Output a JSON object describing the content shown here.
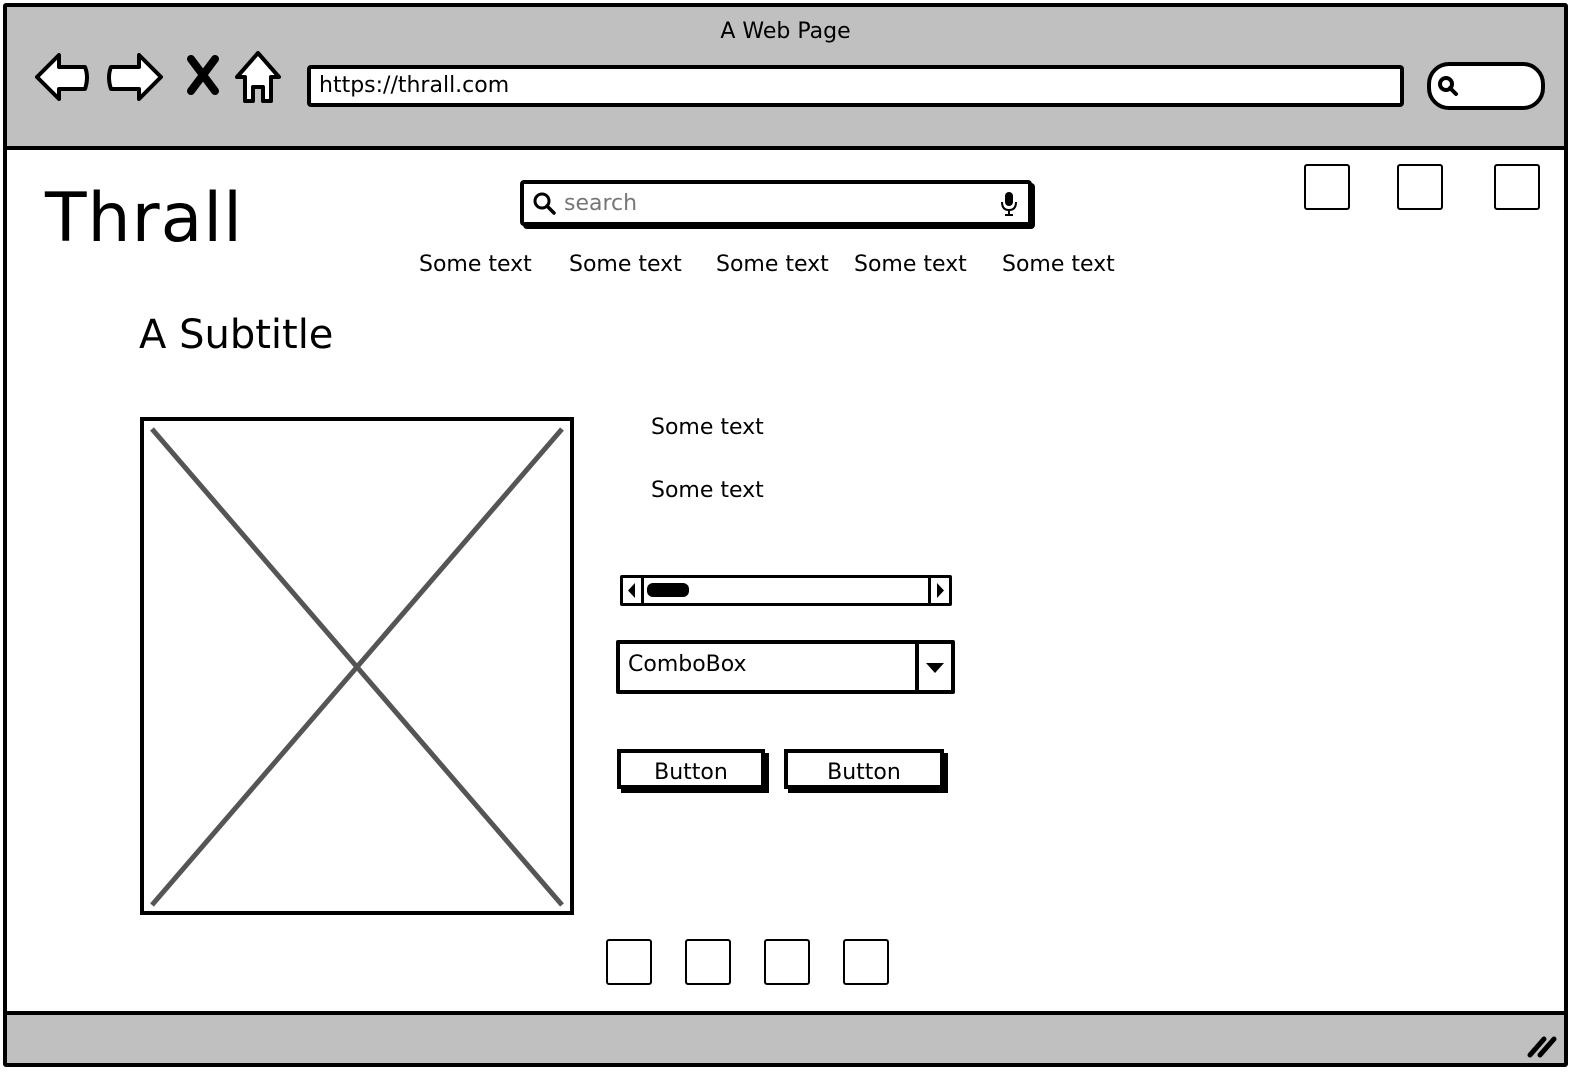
{
  "browser": {
    "window_title": "A Web Page",
    "url": "https://thrall.com",
    "icons": [
      "back-arrow-icon",
      "forward-arrow-icon",
      "stop-icon",
      "home-icon",
      "search-icon"
    ]
  },
  "page": {
    "logo": "Thrall",
    "search": {
      "placeholder": "search"
    },
    "nav_links": [
      "Some text",
      "Some text",
      "Some text",
      "Some text",
      "Some text"
    ],
    "subtitle": "A Subtitle",
    "texts": [
      "Some text",
      "Some text"
    ],
    "combobox": {
      "value": "ComboBox"
    },
    "buttons": [
      "Button",
      "Button"
    ],
    "scrollbar": {
      "position": 0
    }
  }
}
